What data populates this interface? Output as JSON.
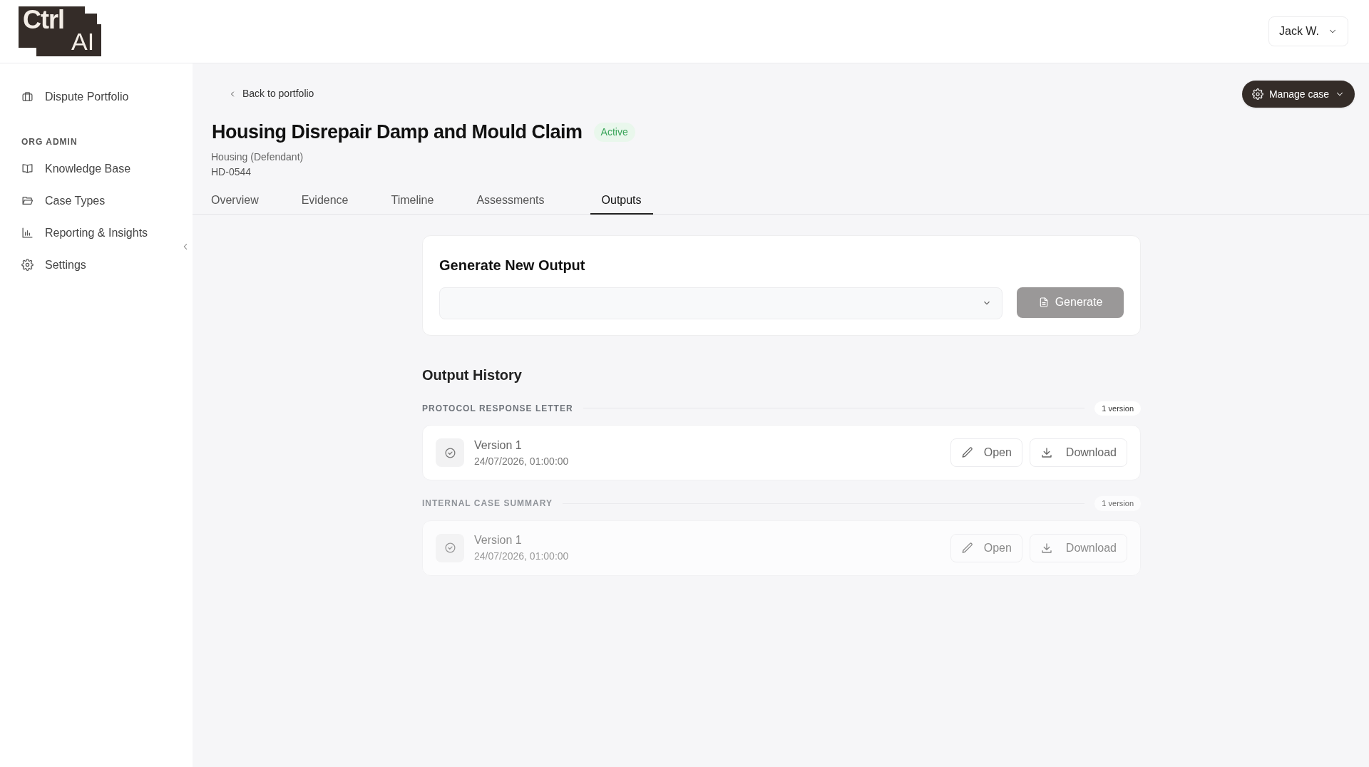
{
  "logo": {
    "line_1": "Ctrl",
    "line_2": "AI"
  },
  "user_menu": {
    "label": "Jack W."
  },
  "sidebar": {
    "items": [
      {
        "label": "Dispute Portfolio",
        "kind": "briefcase",
        "selected": false
      }
    ],
    "sections": [
      {
        "heading": "ORG ADMIN",
        "items": [
          {
            "label": "Knowledge Base",
            "kind": "book",
            "selected": false
          },
          {
            "label": "Case Types",
            "kind": "folder",
            "selected": false
          },
          {
            "label": "Reporting & Insights",
            "kind": "chart",
            "selected": false
          },
          {
            "label": "Settings",
            "kind": "gear",
            "selected": false
          }
        ]
      }
    ]
  },
  "case": {
    "back_link": "Back to portfolio",
    "title": "Housing Disrepair Damp and Mould Claim",
    "status": "Active",
    "subtitle": "Housing (Defendant)",
    "reference": "HD-0544",
    "manage_button": "Manage case"
  },
  "tabs": [
    {
      "label": "Overview",
      "selected": false
    },
    {
      "label": "Evidence",
      "selected": false
    },
    {
      "label": "Timeline",
      "selected": false
    },
    {
      "label": "Assessments",
      "selected": false
    },
    {
      "label": "Outputs",
      "selected": true
    }
  ],
  "generate": {
    "title": "Generate New Output",
    "button": "Generate",
    "disabled": true
  },
  "history": {
    "title": "Output History",
    "groups": [
      {
        "name": "PROTOCOL RESPONSE LETTER",
        "count": "1 version",
        "faded": false,
        "versions": [
          {
            "label": "Version 1",
            "date": "24/07/2026, 01:00:00",
            "open": "Open",
            "download": "Download"
          }
        ]
      },
      {
        "name": "INTERNAL CASE SUMMARY",
        "count": "1 version",
        "faded": true,
        "versions": [
          {
            "label": "Version 1",
            "date": "24/07/2026, 01:00:00",
            "open": "Open",
            "download": "Download"
          }
        ]
      }
    ]
  }
}
